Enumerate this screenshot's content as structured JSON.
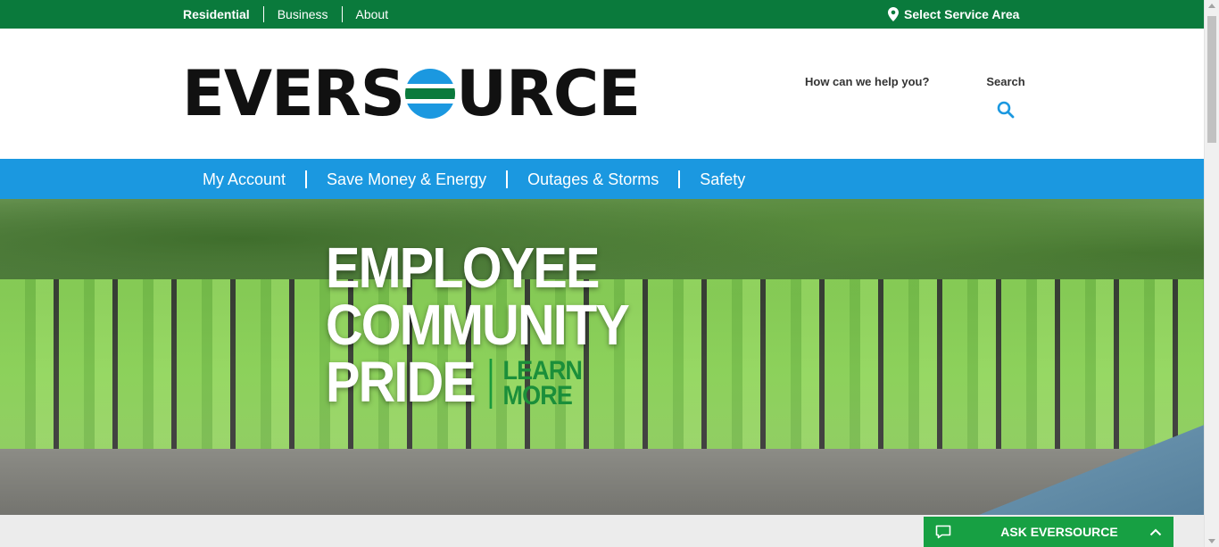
{
  "util_nav": {
    "items": [
      {
        "label": "Residential"
      },
      {
        "label": "Business"
      },
      {
        "label": "About"
      }
    ],
    "service_area": {
      "label": "Select Service Area",
      "icon": "map-pin-icon"
    }
  },
  "header": {
    "logo": {
      "prefix": "EVERS",
      "suffix": "URCE",
      "o_colors": [
        "#1b98e0",
        "#0a7a3c"
      ]
    },
    "help_text": "How can we help you?",
    "search": {
      "label": "Search",
      "icon": "search-icon"
    }
  },
  "main_nav": {
    "items": [
      {
        "label": "My Account"
      },
      {
        "label": "Save Money & Energy"
      },
      {
        "label": "Outages & Storms"
      },
      {
        "label": "Safety"
      }
    ]
  },
  "hero": {
    "line1": "EMPLOYEE",
    "line2": "COMMUNITY",
    "line3": "PRIDE",
    "cta_line1": "LEARN",
    "cta_line2": "MORE"
  },
  "ask_widget": {
    "label": "ASK EVERSOURCE",
    "chat_icon": "chat-icon",
    "toggle_icon": "chevron-up-icon"
  },
  "colors": {
    "brand_green": "#0a7a3c",
    "nav_blue": "#1b98e0",
    "ask_green": "#17a043"
  }
}
